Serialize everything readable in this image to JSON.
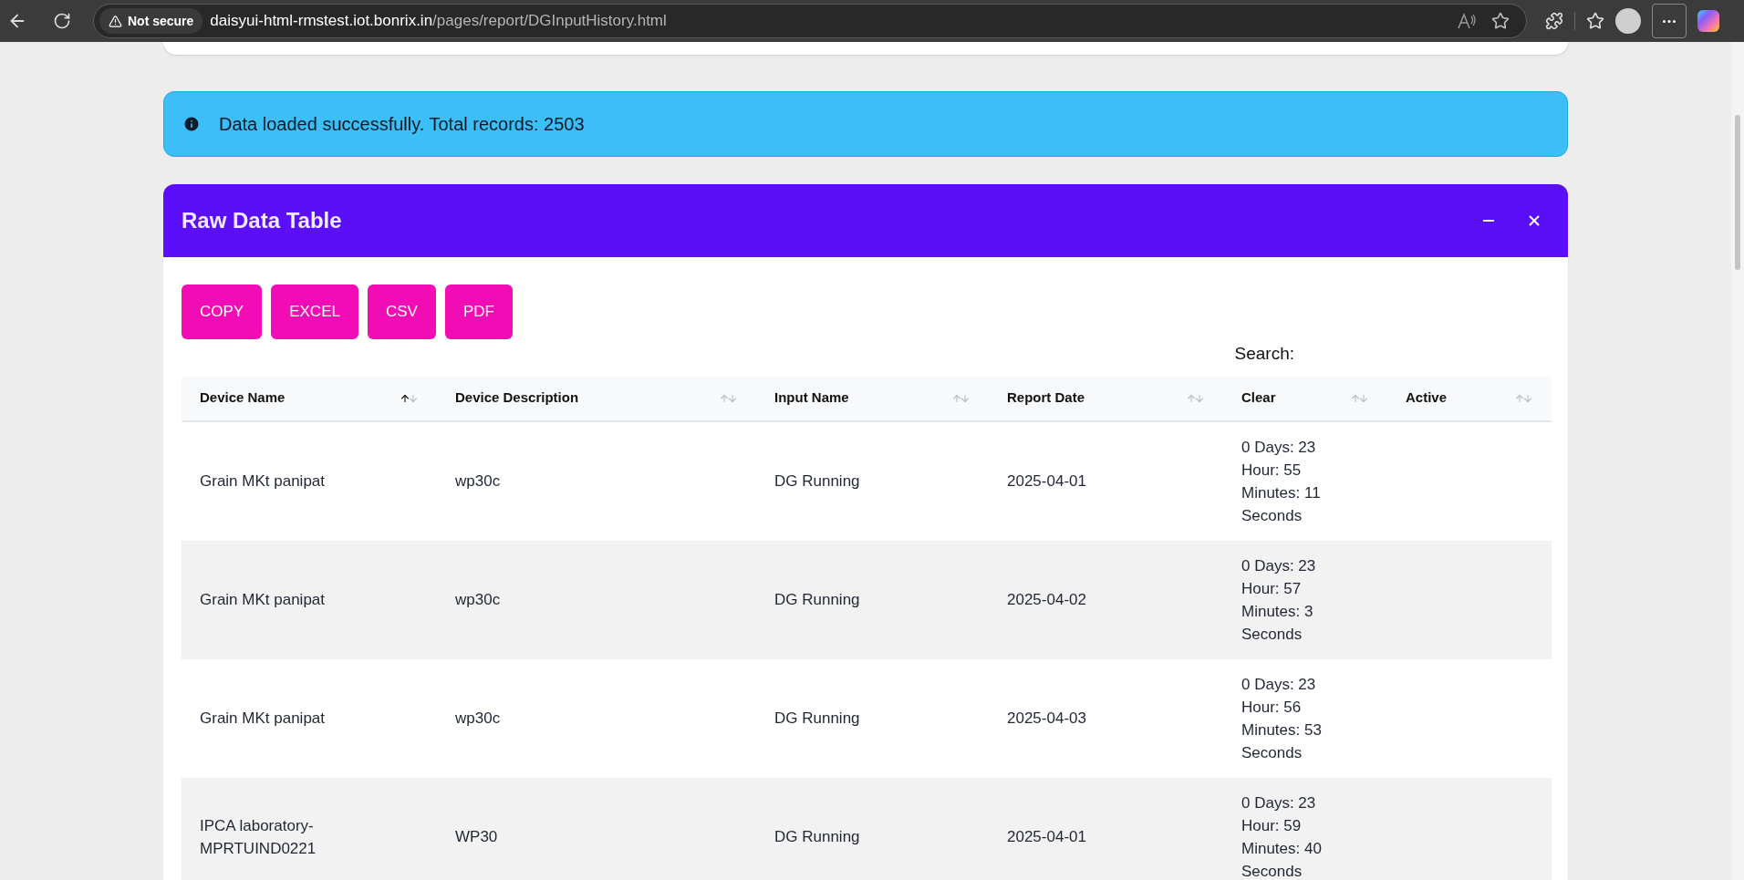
{
  "browser": {
    "security": "Not secure",
    "url_host": "daisyui-html-rmstest.iot.bonrix.in",
    "url_path": "/pages/report/DGInputHistory.html"
  },
  "alert": {
    "text": "Data loaded successfully. Total records: 2503"
  },
  "card": {
    "title": "Raw Data Table"
  },
  "export_buttons": [
    "COPY",
    "EXCEL",
    "CSV",
    "PDF"
  ],
  "search": {
    "label": "Search:"
  },
  "table": {
    "columns": [
      {
        "label": "Device Name",
        "sorted": true
      },
      {
        "label": "Device Description",
        "sorted": false
      },
      {
        "label": "Input Name",
        "sorted": false
      },
      {
        "label": "Report Date",
        "sorted": false
      },
      {
        "label": "Clear",
        "sorted": false
      },
      {
        "label": "Active",
        "sorted": false
      }
    ],
    "rows": [
      [
        "Grain MKt panipat",
        "wp30c",
        "DG Running",
        "2025-04-01",
        "0 Days: 23 Hour: 55 Minutes: 11 Seconds",
        ""
      ],
      [
        "Grain MKt panipat",
        "wp30c",
        "DG Running",
        "2025-04-02",
        "0 Days: 23 Hour: 57 Minutes: 3 Seconds",
        ""
      ],
      [
        "Grain MKt panipat",
        "wp30c",
        "DG Running",
        "2025-04-03",
        "0 Days: 23 Hour: 56 Minutes: 53 Seconds",
        ""
      ],
      [
        "IPCA laboratory-MPRTUIND0221",
        "WP30",
        "DG Running",
        "2025-04-01",
        "0 Days: 23 Hour: 59 Minutes: 40 Seconds",
        ""
      ]
    ]
  }
}
